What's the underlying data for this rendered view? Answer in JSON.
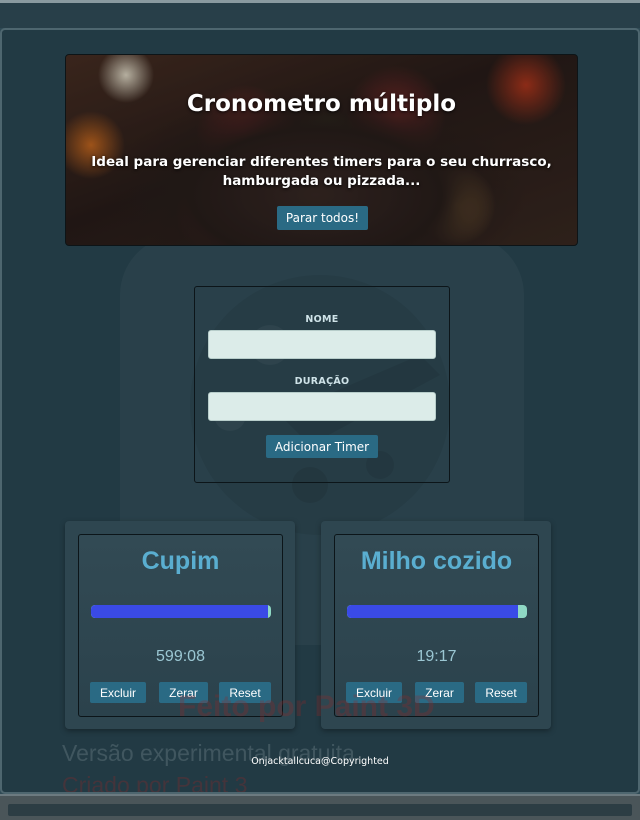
{
  "hero": {
    "title": "Cronometro múltiplo",
    "subtitle": "Ideal para gerenciar diferentes timers para o seu churrasco, hamburgada ou pizzada...",
    "stop_all_label": "Parar todos!"
  },
  "form": {
    "name_label": "NOME",
    "name_value": "",
    "duration_label": "DURAÇÃO",
    "duration_value": "",
    "add_label": "Adicionar Timer"
  },
  "timers": [
    {
      "name": "Cupim",
      "time": "599:08",
      "progress": 0.985,
      "delete_label": "Excluir",
      "zero_label": "Zerar",
      "reset_label": "Reset"
    },
    {
      "name": "Milho cozido",
      "time": "19:17",
      "progress": 0.95,
      "delete_label": "Excluir",
      "zero_label": "Zerar",
      "reset_label": "Reset"
    }
  ],
  "footer": {
    "text": "Onjacktallcuca@Copyrighted"
  },
  "watermark": {
    "line1": "Feito por Paint 3D",
    "line2": "Versão experimental gratuita",
    "line3": "Criado por Paint 3"
  },
  "colors": {
    "accent_button": "#2a6a84",
    "timer_title": "#5aaed0",
    "progress_fill": "#3a4ae6",
    "progress_track": "#8fd8c4"
  }
}
